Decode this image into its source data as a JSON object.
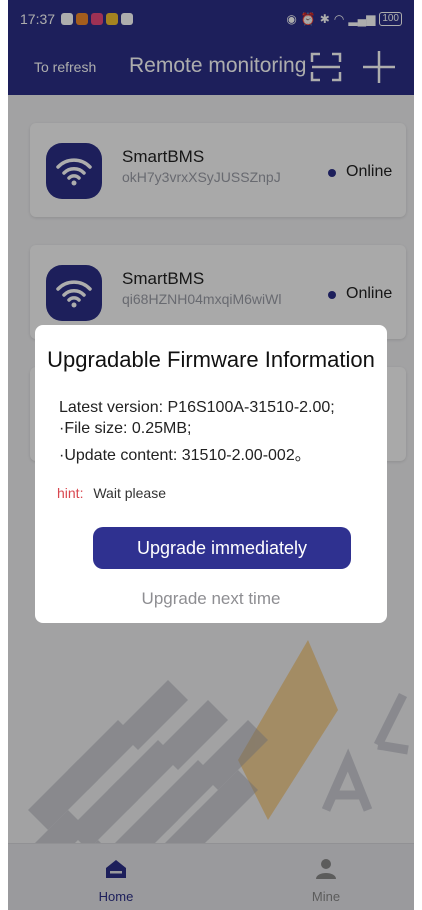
{
  "status_bar": {
    "time": "17:37",
    "battery": "100"
  },
  "header": {
    "refresh_label": "To refresh",
    "title": "Remote monitoring"
  },
  "devices": [
    {
      "name": "SmartBMS",
      "id": "okH7y3vrxXSyJUSSZnpJ",
      "status": "Online"
    },
    {
      "name": "SmartBMS",
      "id": "qi68HZNH04mxqiM6wiWl",
      "status": "Online"
    }
  ],
  "dialog": {
    "title": "Upgradable Firmware Information",
    "latest_version": "Latest version:  P16S100A-31510-2.00;",
    "file_size": "·File size:  0.25MB;",
    "update_content": "·Update content:  31510-2.00-002。",
    "hint_label": "hint:",
    "hint_text": "Wait please",
    "upgrade_button": "Upgrade immediately",
    "later_button": "Upgrade next time"
  },
  "tabs": [
    {
      "label": "Home",
      "active": true
    },
    {
      "label": "Mine",
      "active": false
    }
  ],
  "colors": {
    "primary": "#2b2f86",
    "hint": "#d9474f",
    "watermark": "#f5a623"
  }
}
